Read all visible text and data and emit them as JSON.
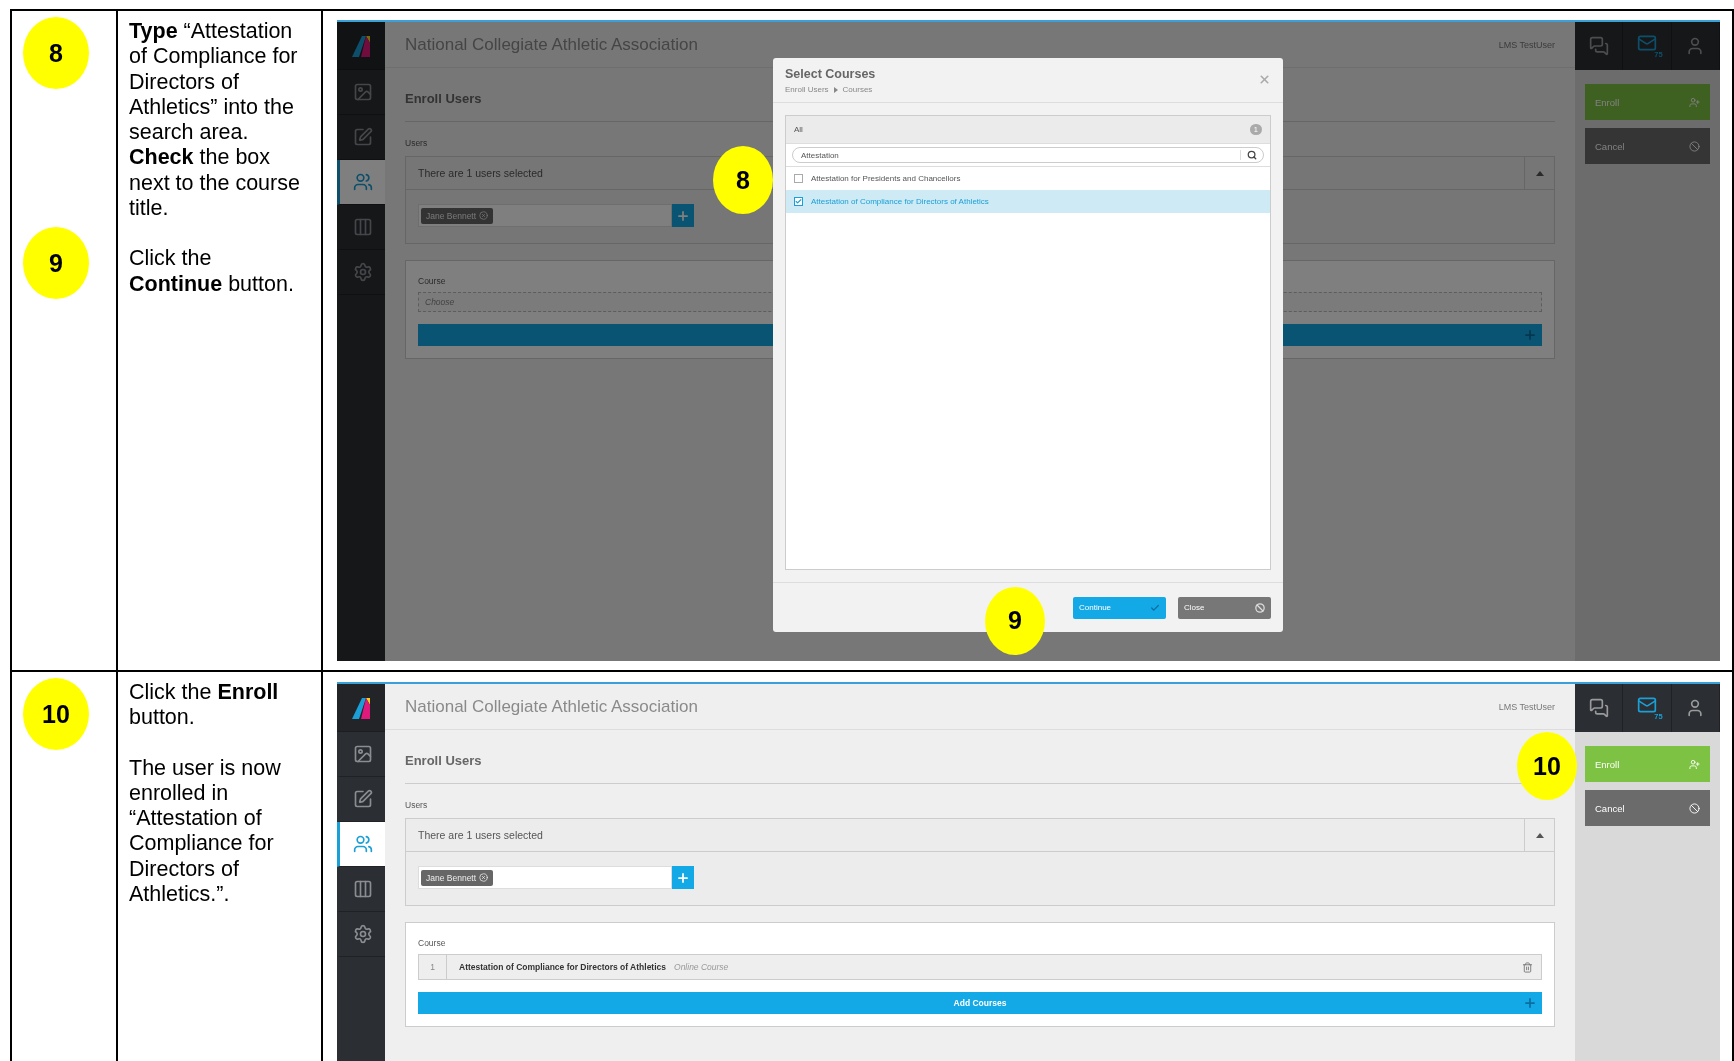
{
  "steps": [
    {
      "badges": [
        "8",
        "9"
      ],
      "paragraphs": [
        "**Type** “Attestation of Compliance for Directors of Athletics” into the search area. **Check** the box next to the course title.",
        "Click the **Continue** button."
      ],
      "screen": {
        "app_title": "National Collegiate Athletic Association",
        "user_name": "LMS TestUser",
        "dimmed": true,
        "sidebar": [
          {
            "kind": "dashboard",
            "selected": false
          },
          {
            "kind": "edit",
            "selected": false
          },
          {
            "kind": "users",
            "selected": true
          },
          {
            "kind": "columns",
            "selected": false
          },
          {
            "kind": "settings",
            "selected": false
          }
        ],
        "top_icons": [
          {
            "kind": "chat"
          },
          {
            "kind": "mail",
            "count": "75"
          },
          {
            "kind": "user"
          }
        ],
        "section_title": "Enroll Users",
        "users_label": "Users",
        "users_summary": "There are 1 users selected",
        "user_chips": [
          "Jane Bennett"
        ],
        "course_label": "Course",
        "course_placeholder": "Choose",
        "actions": [
          {
            "label": "Enroll",
            "kind": "enroll"
          },
          {
            "label": "Cancel",
            "kind": "cancel"
          }
        ],
        "modal": {
          "title": "Select Courses",
          "breadcrumb": [
            "Enroll Users",
            "Courses"
          ],
          "filter_label": "All",
          "count": "1",
          "search_value": "Attestation",
          "callout": "8",
          "results": [
            {
              "title": "Attestation for Presidents and Chancellors",
              "checked": false,
              "selected": false
            },
            {
              "title": "Attestation of Compliance for Directors of Athletics",
              "checked": true,
              "selected": true
            }
          ],
          "buttons": [
            {
              "label": "Continue",
              "kind": "primary",
              "callout": "9"
            },
            {
              "label": "Close",
              "kind": "secondary"
            }
          ]
        }
      }
    },
    {
      "badges": [
        "10"
      ],
      "paragraphs": [
        "Click the **Enroll** button.",
        "The user is now enrolled in “Attestation of Compliance for Directors of Athletics.”."
      ],
      "screen": {
        "app_title": "National Collegiate Athletic Association",
        "user_name": "LMS TestUser",
        "dimmed": false,
        "sidebar": [
          {
            "kind": "dashboard",
            "selected": false
          },
          {
            "kind": "edit",
            "selected": false
          },
          {
            "kind": "users",
            "selected": true
          },
          {
            "kind": "columns",
            "selected": false
          },
          {
            "kind": "settings",
            "selected": false
          }
        ],
        "top_icons": [
          {
            "kind": "chat"
          },
          {
            "kind": "mail",
            "count": "75"
          },
          {
            "kind": "user"
          }
        ],
        "section_title": "Enroll Users",
        "users_label": "Users",
        "users_summary": "There are 1 users selected",
        "user_chips": [
          "Jane Bennett"
        ],
        "course_label": "Course",
        "courses": [
          {
            "number": "1",
            "title": "Attestation of Compliance for Directors of Athletics",
            "type": "Online Course"
          }
        ],
        "add_button": "Add Courses",
        "actions": [
          {
            "label": "Enroll",
            "kind": "enroll",
            "callout": "10"
          },
          {
            "label": "Cancel",
            "kind": "cancel"
          }
        ]
      }
    }
  ]
}
